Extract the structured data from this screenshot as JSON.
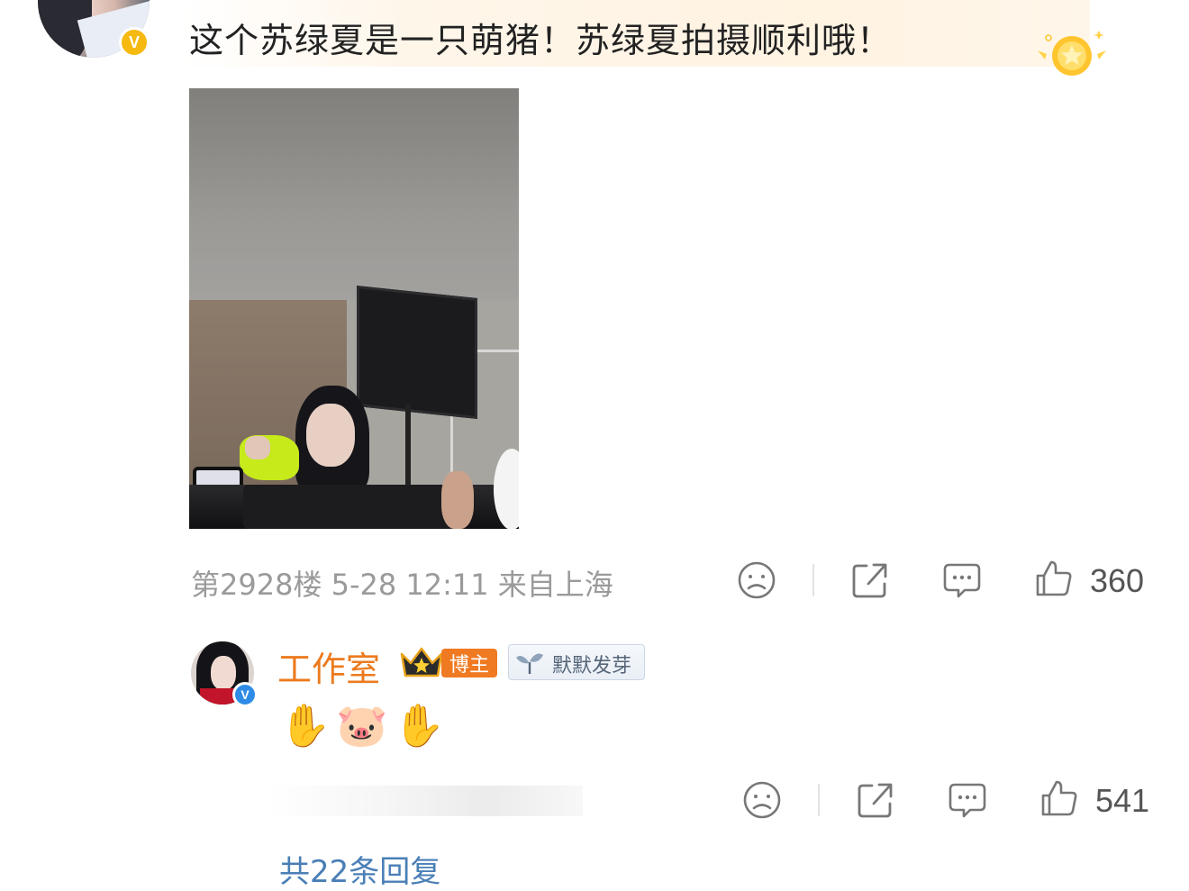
{
  "comment": {
    "text": "这个苏绿夏是一只萌猪！苏绿夏拍摄顺利哦！",
    "floor_info": "第2928楼  5-28 12:11  来自上海",
    "like_count": "360",
    "badge_letter": "V"
  },
  "reply": {
    "author": "工作室",
    "author_badge": "博主",
    "fan_badge": "默默发芽",
    "text": "✋🐷✋",
    "like_count": "541",
    "badge_letter": "V"
  },
  "more_replies_text": "共22条回复",
  "colors": {
    "author_orange": "#ec7a1e",
    "link_blue": "#4a7fb6",
    "meta_gray": "#9a9a9a",
    "verify_gold": "#f5b90f",
    "verify_blue": "#2e8ce6"
  },
  "icons": {
    "dislike": "sad-face-icon",
    "share": "share-icon",
    "comment": "comment-icon",
    "like": "thumbs-up-icon"
  }
}
